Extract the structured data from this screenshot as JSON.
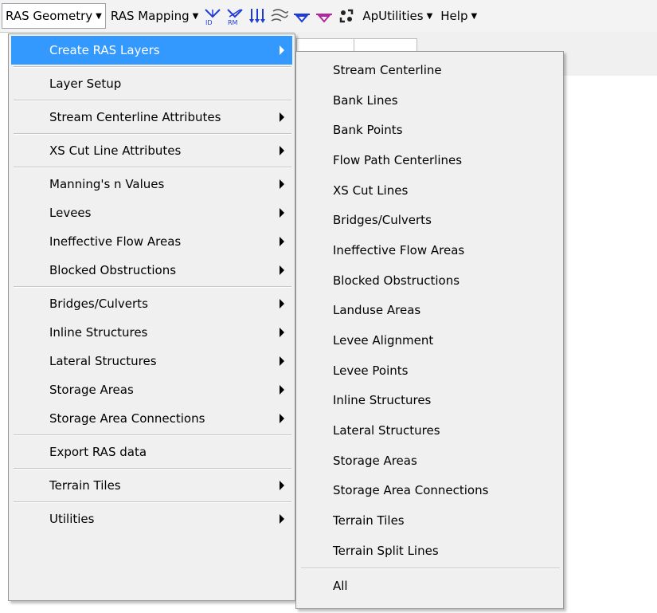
{
  "toolbar": {
    "menus": [
      {
        "label": "RAS Geometry",
        "arrow": "▼"
      },
      {
        "label": "RAS Mapping",
        "arrow": "▼"
      },
      {
        "label": "ApUtilities",
        "arrow": "▼"
      },
      {
        "label": "Help",
        "arrow": "▼"
      }
    ],
    "icons": [
      "id-cut-icon",
      "rm-cut-icon",
      "down-arrows-icon",
      "stream-lines-icon",
      "level-arrow-icon",
      "level-arrow-purple-icon",
      "refresh-dots-icon"
    ]
  },
  "menu": {
    "items": [
      {
        "label": "Create RAS Layers",
        "has_submenu": true,
        "highlighted": true
      },
      {
        "label": "Layer Setup",
        "has_submenu": false
      },
      {
        "label": "Stream Centerline Attributes",
        "has_submenu": true
      },
      {
        "label": "XS Cut Line Attributes",
        "has_submenu": true
      },
      {
        "label": "Manning's n Values",
        "has_submenu": true
      },
      {
        "label": "Levees",
        "has_submenu": true
      },
      {
        "label": "Ineffective Flow Areas",
        "has_submenu": true
      },
      {
        "label": "Blocked Obstructions",
        "has_submenu": true
      },
      {
        "label": "Bridges/Culverts",
        "has_submenu": true
      },
      {
        "label": "Inline Structures",
        "has_submenu": true
      },
      {
        "label": "Lateral Structures",
        "has_submenu": true
      },
      {
        "label": "Storage Areas",
        "has_submenu": true
      },
      {
        "label": "Storage Area Connections",
        "has_submenu": true
      },
      {
        "label": "Export RAS data",
        "has_submenu": false
      },
      {
        "label": "Terrain Tiles",
        "has_submenu": true
      },
      {
        "label": "Utilities",
        "has_submenu": true
      }
    ]
  },
  "submenu": {
    "items": [
      "Stream Centerline",
      "Bank Lines",
      "Bank Points",
      "Flow Path Centerlines",
      "XS Cut Lines",
      "Bridges/Culverts",
      "Ineffective Flow Areas",
      "Blocked Obstructions",
      "Landuse Areas",
      "Levee Alignment",
      "Levee Points",
      "Inline Structures",
      "Lateral Structures",
      "Storage Areas",
      "Storage Area Connections",
      "Terrain Tiles",
      "Terrain Split Lines",
      "All"
    ]
  },
  "colors": {
    "highlight": "#3399ff",
    "menu_bg": "#f0f0f0",
    "icon_blue": "#1f3bd6",
    "icon_purple": "#b0289c"
  }
}
